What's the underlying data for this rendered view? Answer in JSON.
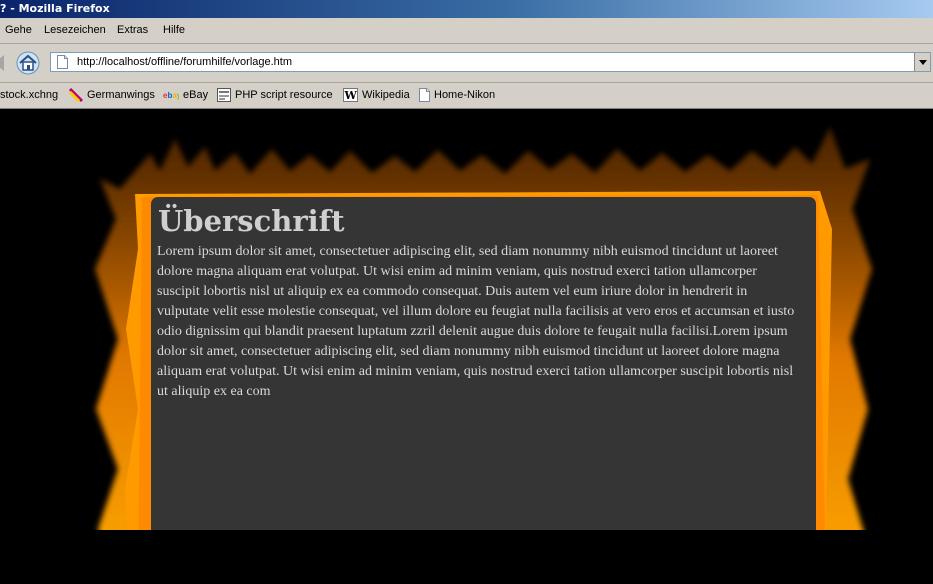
{
  "window": {
    "title": "? - Mozilla Firefox"
  },
  "menu": {
    "items": [
      {
        "label": "Gehe",
        "accel": "G"
      },
      {
        "label": "Lesezeichen",
        "accel": "L"
      },
      {
        "label": "Extras",
        "accel": "E"
      },
      {
        "label": "Hilfe",
        "accel": "H"
      }
    ]
  },
  "navbar": {
    "url": "http://localhost/offline/forumhilfe/vorlage.htm"
  },
  "bookmarks": [
    {
      "label": "stock.xchng",
      "icon": "none"
    },
    {
      "label": "Germanwings",
      "icon": "germanwings-icon"
    },
    {
      "label": "eBay",
      "icon": "ebay-icon"
    },
    {
      "label": "PHP script resource",
      "icon": "php-icon"
    },
    {
      "label": "Wikipedia",
      "icon": "wikipedia-icon"
    },
    {
      "label": "Home-Nikon",
      "icon": "page-icon"
    }
  ],
  "page": {
    "heading": "Überschrift",
    "body": "Lorem ipsum dolor sit amet, consectetuer adipiscing elit, sed diam nonummy nibh euismod tincidunt ut laoreet dolore magna aliquam erat volutpat. Ut wisi enim ad minim veniam, quis nostrud exerci tation ullamcorper suscipit lobortis nisl ut aliquip ex ea commodo consequat. Duis autem vel eum iriure dolor in hendrerit in vulputate velit esse molestie consequat, vel illum dolore eu feugiat nulla facilisis at vero eros et accumsan et iusto odio dignissim qui blandit praesent luptatum zzril delenit augue duis dolore te feugait nulla facilisi.Lorem ipsum dolor sit amet, consectetuer adipiscing elit, sed diam nonummy nibh euismod tincidunt ut laoreet dolore magna aliquam erat volutpat. Ut wisi enim ad minim veniam, quis nostrud exerci tation ullamcorper suscipit lobortis nisl ut aliquip ex ea com"
  },
  "colors": {
    "titlebar": "#0a246a",
    "chrome": "#d4d0c8",
    "page_background": "#000000",
    "flame_orange": "#ff9a00",
    "panel": "#353535",
    "panel_text": "#d9d9d9"
  }
}
